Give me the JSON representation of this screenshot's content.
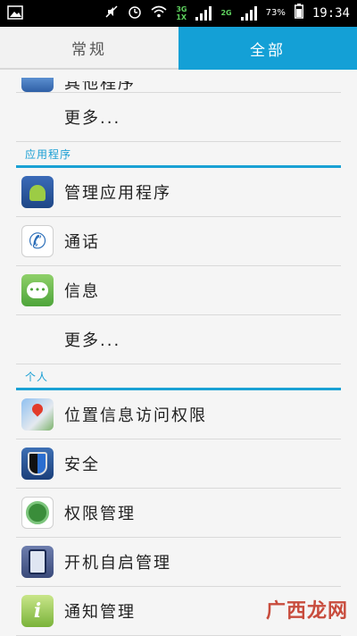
{
  "status_bar": {
    "network_top": "3G",
    "network_bottom": "1X",
    "network2": "2G",
    "battery": "73%",
    "time": "19:34"
  },
  "tabs": {
    "general": "常规",
    "all": "全部"
  },
  "list": {
    "partial_item": "其他程序",
    "more1": "更多...",
    "section_apps": "应用程序",
    "app_manager": "管理应用程序",
    "call": "通话",
    "messages": "信息",
    "more2": "更多...",
    "section_personal": "个人",
    "location": "位置信息访问权限",
    "security": "安全",
    "permission": "权限管理",
    "autostart": "开机自启管理",
    "notification": "通知管理"
  },
  "watermark": "广西龙网",
  "colors": {
    "accent": "#14a0d6",
    "section_line": "#1aa1d4"
  }
}
